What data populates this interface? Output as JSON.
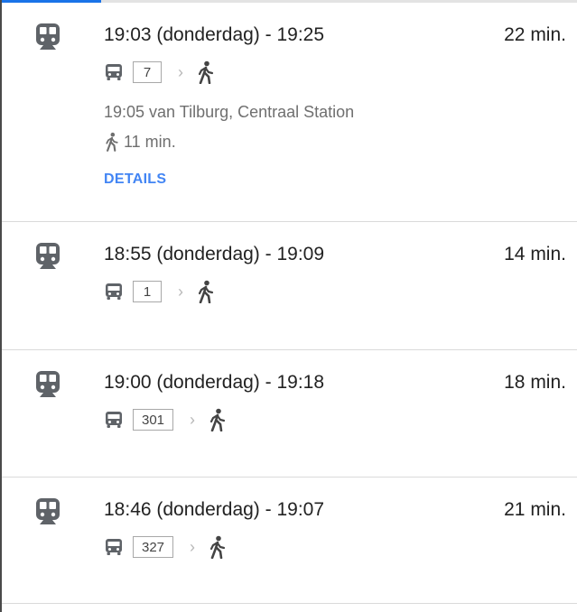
{
  "colors": {
    "accent": "#4285f4",
    "text_primary": "#222222",
    "text_secondary": "#6f6f6f",
    "divider": "#dadada",
    "icon": "#5f6368"
  },
  "routes": [
    {
      "mode_icon": "train-icon",
      "times": "19:03 (donderdag) - 19:25",
      "duration": "22 min.",
      "line": "7",
      "departure_info": "19:05 van Tilburg, Centraal Station",
      "walk_time": "11 min.",
      "details_label": "DETAILS"
    },
    {
      "mode_icon": "train-icon",
      "times": "18:55 (donderdag) - 19:09",
      "duration": "14 min.",
      "line": "1"
    },
    {
      "mode_icon": "train-icon",
      "times": "19:00 (donderdag) - 19:18",
      "duration": "18 min.",
      "line": "301"
    },
    {
      "mode_icon": "train-icon",
      "times": "18:46 (donderdag) - 19:07",
      "duration": "21 min.",
      "line": "327"
    }
  ]
}
